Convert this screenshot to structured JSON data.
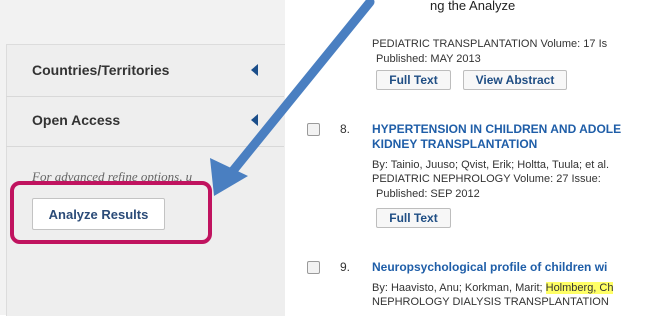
{
  "annotation": {
    "top_label": "ng the Analyze"
  },
  "sidebar": {
    "facets": [
      {
        "label": "Countries/Territories"
      },
      {
        "label": "Open Access"
      }
    ],
    "advanced_text": "For advanced refine options, u",
    "analyze_button": "Analyze Results"
  },
  "results": {
    "prev": {
      "source": "PEDIATRIC TRANSPLANTATION  Volume: 17   Is",
      "published": "Published: MAY 2013",
      "full_text": "Full Text",
      "view_abstract": "View Abstract"
    },
    "r8": {
      "number": "8.",
      "title_line1": "HYPERTENSION IN CHILDREN AND ADOLE",
      "title_line2": "KIDNEY TRANSPLANTATION",
      "authors": "By: Tainio, Juuso; Qvist, Erik; Holtta, Tuula; et al.",
      "source": "PEDIATRIC NEPHROLOGY  Volume: 27   Issue:",
      "published": "Published: SEP 2012",
      "full_text": "Full Text"
    },
    "r9": {
      "number": "9.",
      "title": "Neuropsychological profile of children wi",
      "authors_prefix": "By: Haavisto, Anu; Korkman, Marit; ",
      "authors_highlight": "Holmberg, Ch",
      "source": "NEPHROLOGY DIALYSIS TRANSPLANTATION"
    }
  },
  "colors": {
    "highlight_box": "#c0135f",
    "arrow": "#4a7fc1",
    "link": "#1f5ea8"
  }
}
